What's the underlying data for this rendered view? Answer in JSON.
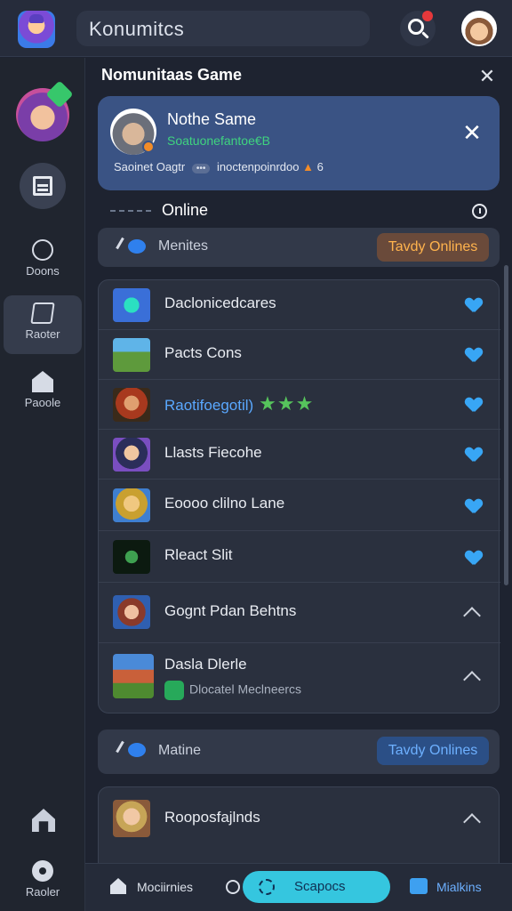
{
  "topbar": {
    "search_text": "Konumitcs"
  },
  "rail": {
    "items": [
      {
        "label": "Doons"
      },
      {
        "label": "Raoter"
      },
      {
        "label": "Paoole"
      }
    ],
    "bottom_label": "Raoler"
  },
  "panel": {
    "title": "Nomunitaas Game",
    "close": "✕",
    "profile": {
      "name": "Nothe Same",
      "subtitle": "Soatuonefantoe€B",
      "meta_left": "Saoinet Oagtr",
      "meta_pill": "•••",
      "meta_right": "inoctenpoinrdoo",
      "meta_count": "6",
      "close": "✕"
    },
    "online": {
      "title": "Online"
    },
    "filter1": {
      "label": "Menites",
      "button": "Tavdy Onlines"
    },
    "games": [
      {
        "name": "Daclonicedcares",
        "action": "favorite"
      },
      {
        "name": "Pacts Cons",
        "action": "favorite"
      },
      {
        "name": "Raotifoegotil)",
        "stars": "★★★",
        "action": "favorite"
      },
      {
        "name": "Llasts Fiecohe",
        "action": "favorite"
      },
      {
        "name": "Eoooo clilno Lane",
        "action": "favorite"
      },
      {
        "name": "Rleact Slit",
        "action": "favorite"
      },
      {
        "name": "Gognt Pdan Behtns",
        "action": "expand"
      },
      {
        "name": "Dasla Dlerle",
        "subtitle": "Dlocatel Meclneercs",
        "action": "expand"
      }
    ],
    "filter2": {
      "label": "Matine",
      "button": "Tavdy Onlines"
    },
    "bottom_item": {
      "name": "Rooposfajlnds"
    }
  },
  "bottom_nav": {
    "home": "Mociirnies",
    "spaces": "Scapocs",
    "messages": "Mialkins"
  },
  "colors": {
    "background": "#1e2330",
    "profile_card": "#3a5384",
    "accent_blue": "#38a6f5",
    "accent_green": "#3fd37f",
    "accent_orange": "#ffb34d",
    "spaces_button": "#35c6df"
  }
}
